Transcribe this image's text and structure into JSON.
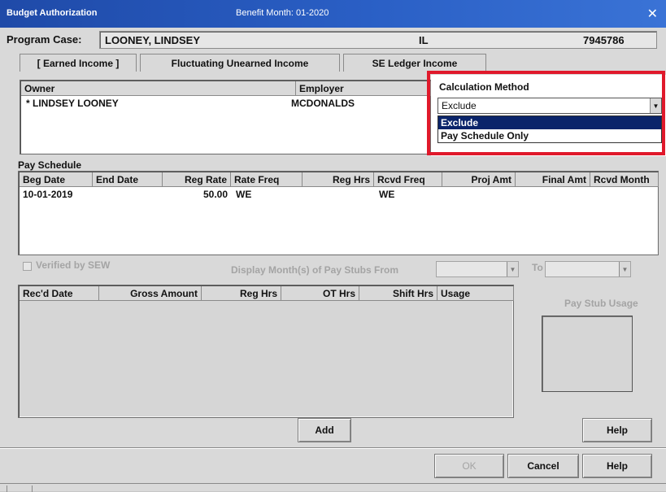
{
  "window": {
    "title": "Budget Authorization",
    "benefit_month": "Benefit Month: 01-2020",
    "close_glyph": "✕"
  },
  "program_case": {
    "label": "Program Case:",
    "name": "LOONEY, LINDSEY",
    "state": "IL",
    "case_number": "7945786"
  },
  "tabs": [
    {
      "label": "[ Earned Income ]"
    },
    {
      "label": "Fluctuating Unearned Income"
    },
    {
      "label": "SE Ledger Income"
    }
  ],
  "owner_table": {
    "headers": [
      "Owner",
      "Employer"
    ],
    "rows": [
      {
        "owner": "* LINDSEY LOONEY",
        "employer": "MCDONALDS"
      }
    ]
  },
  "calculation_method": {
    "label": "Calculation Method",
    "selected": "Exclude",
    "options": [
      "Exclude",
      "Pay Schedule Only"
    ],
    "highlight_color": "#e0192b"
  },
  "pay_schedule": {
    "label": "Pay Schedule",
    "headers": [
      "Beg Date",
      "End Date",
      "Reg Rate",
      "Rate Freq",
      "Reg Hrs",
      "Rcvd Freq",
      "Proj Amt",
      "Final Amt",
      "Rcvd Month"
    ],
    "rows": [
      {
        "beg_date": "10-01-2019",
        "end_date": "",
        "reg_rate": "50.00",
        "rate_freq": "WE",
        "reg_hrs": "",
        "rcvd_freq": "WE",
        "proj_amt": "",
        "final_amt": "",
        "rcvd_month": ""
      }
    ]
  },
  "verified": {
    "label": "Verified by SEW",
    "display_from_label": "Display Month(s) of Pay Stubs From",
    "to_label": "To"
  },
  "stub_table": {
    "headers": [
      "Rec'd Date",
      "Gross Amount",
      "Reg Hrs",
      "OT Hrs",
      "Shift Hrs",
      "Usage"
    ]
  },
  "pay_stub_usage": {
    "label": "Pay Stub Usage"
  },
  "buttons": {
    "add": "Add",
    "help_inner": "Help",
    "ok": "OK",
    "cancel": "Cancel",
    "help": "Help"
  },
  "colors": {
    "title_bar": "#1f4aa8",
    "selection": "#0a246a"
  }
}
